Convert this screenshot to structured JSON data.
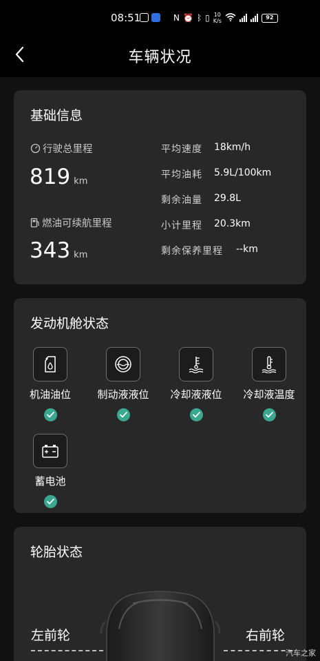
{
  "status_bar": {
    "time": "08:51",
    "net_speed_value": "10",
    "net_speed_unit": "K/s",
    "battery": "92"
  },
  "header": {
    "title": "车辆状况"
  },
  "basic_info": {
    "title": "基础信息",
    "total_mileage_label": "行驶总里程",
    "total_mileage_value": "819",
    "total_mileage_unit": "km",
    "range_label": "燃油可续航里程",
    "range_value": "343",
    "range_unit": "km",
    "details": [
      {
        "label": "平均速度",
        "value": "18km/h"
      },
      {
        "label": "平均油耗",
        "value": "5.9L/100km"
      },
      {
        "label": "剩余油量",
        "value": "29.8L"
      },
      {
        "label": "小计里程",
        "value": "20.3km"
      },
      {
        "label": "剩余保养里程",
        "value": "--km"
      }
    ]
  },
  "engine_status": {
    "title": "发动机舱状态",
    "items": [
      {
        "label": "机油油位",
        "icon": "oil-level-icon",
        "status": "normal"
      },
      {
        "label": "制动液液位",
        "icon": "brake-fluid-icon",
        "status": "normal"
      },
      {
        "label": "冷却液液位",
        "icon": "coolant-level-icon",
        "status": "normal"
      },
      {
        "label": "冷却液温度",
        "icon": "coolant-temperature-icon",
        "status": "normal"
      },
      {
        "label": "蓄电池",
        "icon": "battery-icon",
        "status": "normal"
      }
    ]
  },
  "tire_status": {
    "title": "轮胎状态",
    "front_left": "左前轮",
    "front_right": "右前轮"
  },
  "watermark": "汽车之家",
  "colors": {
    "background": "#111111",
    "card": "#282828",
    "ok_green": "#3aa890"
  }
}
